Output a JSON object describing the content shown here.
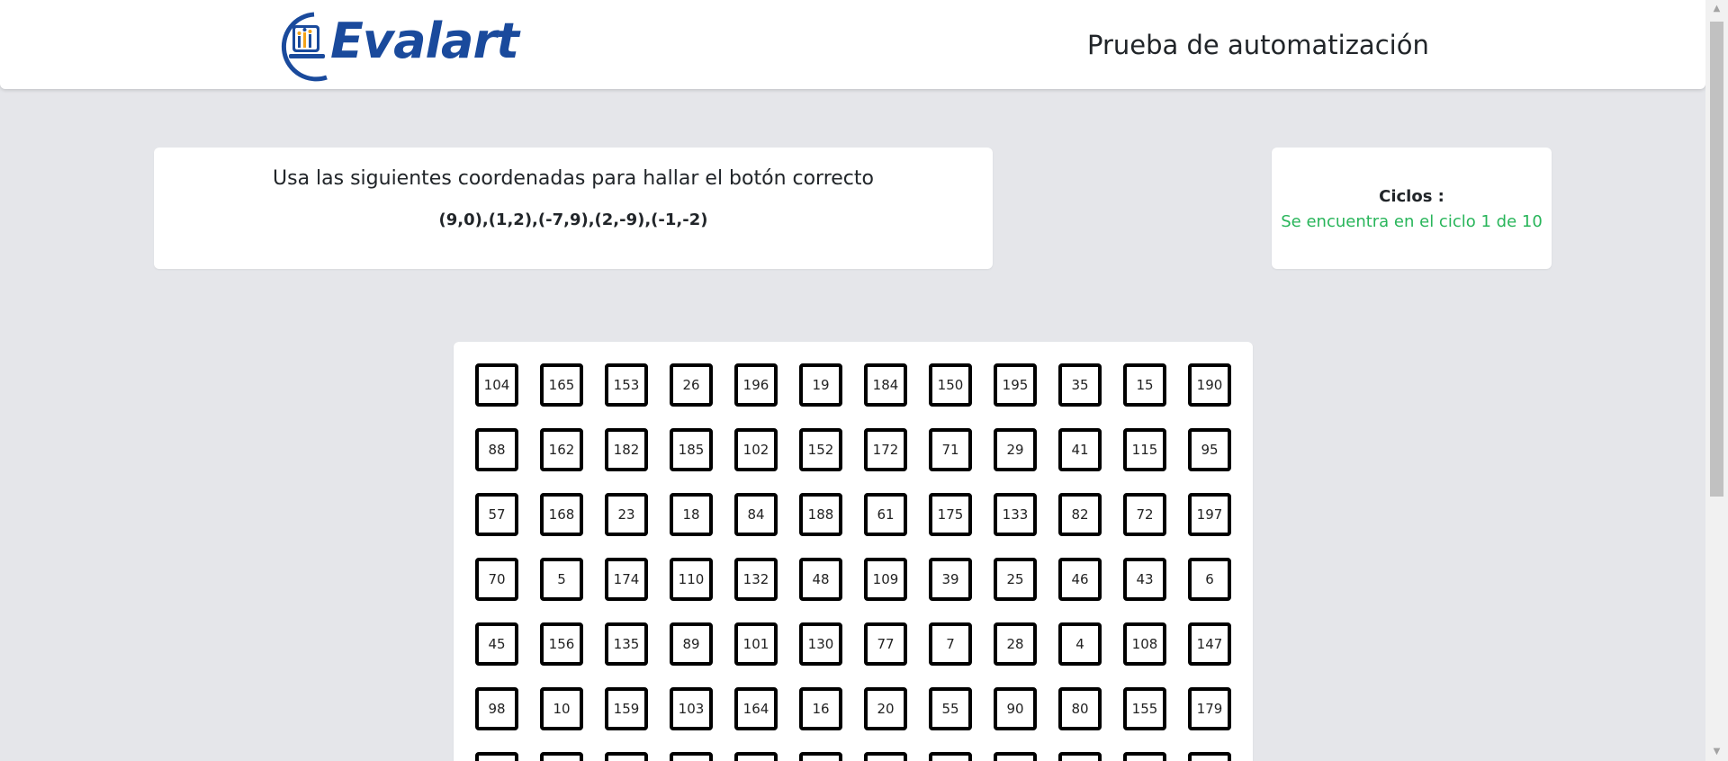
{
  "header": {
    "logo_text": "Evalart",
    "title": "Prueba de automatización"
  },
  "instructions": {
    "text": "Usa las siguientes coordenadas para hallar el botón correcto",
    "coordinates": "(9,0),(1,2),(-7,9),(2,-9),(-1,-2)"
  },
  "cycles": {
    "label": "Ciclos :",
    "status": "Se encuentra en el ciclo 1 de 10"
  },
  "grid": {
    "rows": [
      [
        "104",
        "165",
        "153",
        "26",
        "196",
        "19",
        "184",
        "150",
        "195",
        "35",
        "15",
        "190"
      ],
      [
        "88",
        "162",
        "182",
        "185",
        "102",
        "152",
        "172",
        "71",
        "29",
        "41",
        "115",
        "95"
      ],
      [
        "57",
        "168",
        "23",
        "18",
        "84",
        "188",
        "61",
        "175",
        "133",
        "82",
        "72",
        "197"
      ],
      [
        "70",
        "5",
        "174",
        "110",
        "132",
        "48",
        "109",
        "39",
        "25",
        "46",
        "43",
        "6"
      ],
      [
        "45",
        "156",
        "135",
        "89",
        "101",
        "130",
        "77",
        "7",
        "28",
        "4",
        "108",
        "147"
      ],
      [
        "98",
        "10",
        "159",
        "103",
        "164",
        "16",
        "20",
        "55",
        "90",
        "80",
        "155",
        "179"
      ],
      [
        "",
        "",
        "",
        "",
        "",
        "",
        "",
        "",
        "",
        "",
        "",
        ""
      ]
    ]
  },
  "colors": {
    "page_background": "#e5e6ea",
    "brand_blue": "#1a4a9c",
    "status_green": "#28b55a"
  }
}
